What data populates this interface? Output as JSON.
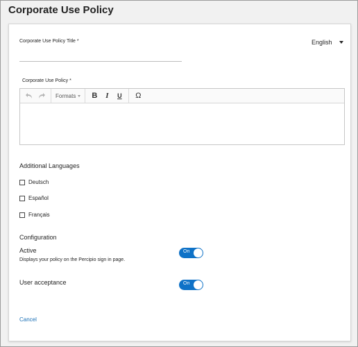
{
  "page": {
    "title": "Corporate Use Policy"
  },
  "form": {
    "title_label": "Corporate Use Policy Title *",
    "title_value": "",
    "language_selected": "English",
    "policy_label": "Corporate Use Policy *",
    "policy_value": ""
  },
  "editor_toolbar": {
    "undo_icon": "undo-icon",
    "redo_icon": "redo-icon",
    "formats_label": "Formats",
    "bold_glyph": "B",
    "italic_glyph": "I",
    "underline_glyph": "U",
    "special_char_glyph": "Ω"
  },
  "additional_languages": {
    "heading": "Additional Languages",
    "items": [
      {
        "label": "Deutsch",
        "checked": false
      },
      {
        "label": "Español",
        "checked": false
      },
      {
        "label": "Français",
        "checked": false
      }
    ]
  },
  "configuration": {
    "heading": "Configuration",
    "active": {
      "title": "Active",
      "description": "Displays your policy on the Percipio sign in page.",
      "toggle_label": "On",
      "enabled": true
    },
    "user_acceptance": {
      "title": "User acceptance",
      "toggle_label": "On",
      "enabled": true
    }
  },
  "actions": {
    "cancel_label": "Cancel"
  },
  "colors": {
    "accent": "#0f72c7",
    "link": "#1a6fb5"
  }
}
